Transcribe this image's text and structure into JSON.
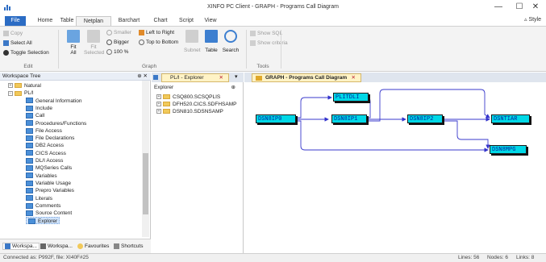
{
  "window": {
    "title": "XINFO PC Client - GRAPH - Programs Call Diagram",
    "minimize": "—",
    "maximize": "☐",
    "close": "✕"
  },
  "menu": {
    "tabs": [
      "File",
      "Home",
      "Table",
      "Netplan",
      "Barchart",
      "Chart",
      "Script",
      "View"
    ],
    "active": "Netplan",
    "style_label": "Style"
  },
  "ribbon": {
    "edit": {
      "copy": "Copy",
      "select_all": "Select All",
      "toggle_selection": "Toggle Selection",
      "label": "Edit"
    },
    "graph": {
      "fit_all": "Fit\nAll",
      "fit_selected": "Fit\nSelected",
      "smaller": "Smaller",
      "bigger": "Bigger",
      "zoom": "100 %",
      "left_to_right": "Left to Right",
      "top_to_bottom": "Top to Bottom",
      "subnet": "Subnet",
      "table": "Table",
      "search": "Search",
      "label": "Graph"
    },
    "tools": {
      "show_sql": "Show SQL",
      "show_criteria": "Show criteria",
      "label": "Tools"
    }
  },
  "workspace": {
    "title": "Workspace Tree",
    "pin": "⊕ ✕",
    "items": [
      {
        "label": "Natural",
        "level": 0,
        "type": "folder",
        "toggle": "+"
      },
      {
        "label": "PL/I",
        "level": 0,
        "type": "folder",
        "toggle": "−"
      },
      {
        "label": "General Information",
        "level": 1,
        "type": "doc"
      },
      {
        "label": "Include",
        "level": 1,
        "type": "doc"
      },
      {
        "label": "Call",
        "level": 1,
        "type": "doc"
      },
      {
        "label": "Procedures/Functions",
        "level": 1,
        "type": "doc"
      },
      {
        "label": "File Access",
        "level": 1,
        "type": "doc"
      },
      {
        "label": "File Declarations",
        "level": 1,
        "type": "doc"
      },
      {
        "label": "DB2 Access",
        "level": 1,
        "type": "doc"
      },
      {
        "label": "CICS Access",
        "level": 1,
        "type": "doc"
      },
      {
        "label": "DL/I Access",
        "level": 1,
        "type": "doc"
      },
      {
        "label": "MQSeries Calls",
        "level": 1,
        "type": "doc"
      },
      {
        "label": "Variables",
        "level": 1,
        "type": "doc"
      },
      {
        "label": "Variable Usage",
        "level": 1,
        "type": "doc"
      },
      {
        "label": "Prepro Variables",
        "level": 1,
        "type": "doc"
      },
      {
        "label": "Literals",
        "level": 1,
        "type": "doc"
      },
      {
        "label": "Comments",
        "level": 1,
        "type": "doc"
      },
      {
        "label": "Source Content",
        "level": 1,
        "type": "doc"
      },
      {
        "label": "Explorer",
        "level": 1,
        "type": "doc",
        "selected": true
      }
    ],
    "bottom_tabs": [
      "Workspa...",
      "Workspa...",
      "Favourites",
      "Shortcuts"
    ]
  },
  "explorer": {
    "tab_label": "PL/I - Explorer",
    "tab_close": "✕",
    "header": "Explorer",
    "header_pin": "⊕",
    "items": [
      "CSQ800.SCSQPLIS",
      "DFH520.CICS.SDFHSAMP",
      "DSN810.SDSNSAMP"
    ]
  },
  "diagram": {
    "tab_label": "GRAPH - Programs Call Diagram",
    "tab_close": "✕",
    "nodes": [
      "DSN8IP0",
      "DSN8IP1",
      "DSN8IP2",
      "DSNTIAR",
      "PLITDLI",
      "DSN8MPG"
    ]
  },
  "status": {
    "left": "Connected as: P992F, file: XI40F#25",
    "lines": "Lines: 56",
    "nodes": "Nodes: 6",
    "links": "Links: 8"
  }
}
